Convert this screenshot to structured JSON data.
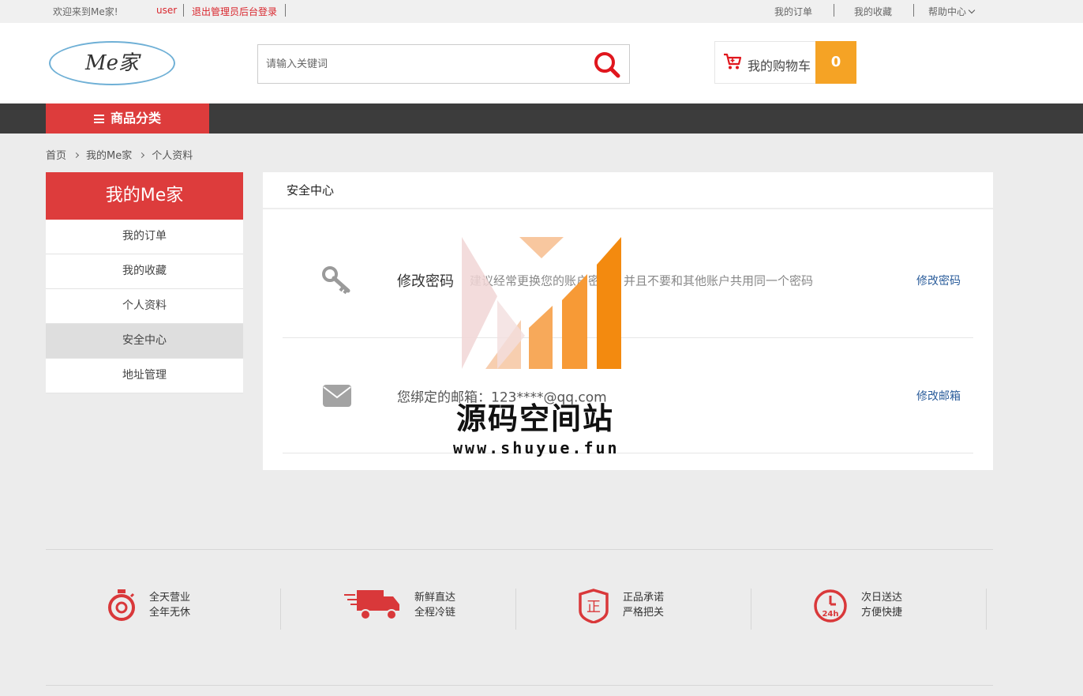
{
  "topbar": {
    "welcome": "欢迎来到Me家!",
    "user": "user",
    "logout": "退出管理员后台登录",
    "my_orders": "我的订单",
    "my_favorites": "我的收藏",
    "help_center": "帮助中心"
  },
  "header": {
    "logo_text": "Me家",
    "search_placeholder": "请输入关键词",
    "cart_label": "我的购物车",
    "cart_count": "0"
  },
  "nav": {
    "category_label": "商品分类"
  },
  "breadcrumb": [
    "首页",
    "我的Me家",
    "个人资料"
  ],
  "sidebar": {
    "title": "我的Me家",
    "items": [
      {
        "label": "我的订单"
      },
      {
        "label": "我的收藏"
      },
      {
        "label": "个人资料"
      },
      {
        "label": "安全中心",
        "active": true
      },
      {
        "label": "地址管理"
      }
    ]
  },
  "panel": {
    "title": "安全中心",
    "rows": [
      {
        "title": "修改密码",
        "desc": "建议经常更换您的账户密码，并且不要和其他账户共用同一个密码",
        "link": "修改密码",
        "icon": "key-icon"
      },
      {
        "desc": "您绑定的邮箱：123****@qq.com",
        "link": "修改邮箱",
        "icon": "envelope-icon"
      }
    ]
  },
  "watermark": {
    "title": "源码空间站",
    "url": "www.shuyue.fun"
  },
  "features": [
    {
      "line1": "全天营业",
      "line2": "全年无休",
      "icon": "stopwatch-icon"
    },
    {
      "line1": "新鲜直达",
      "line2": "全程冷链",
      "icon": "delivery-truck-icon"
    },
    {
      "line1": "正品承诺",
      "line2": "严格把关",
      "icon": "authentic-badge-icon"
    },
    {
      "line1": "次日送达",
      "line2": "方便快捷",
      "icon": "clock-24h-icon"
    }
  ],
  "colors": {
    "brand_red": "#dd3c3c",
    "cart_orange": "#f5a325",
    "nav_dark": "#3c3c3c",
    "link_blue": "#2b5d9b"
  }
}
